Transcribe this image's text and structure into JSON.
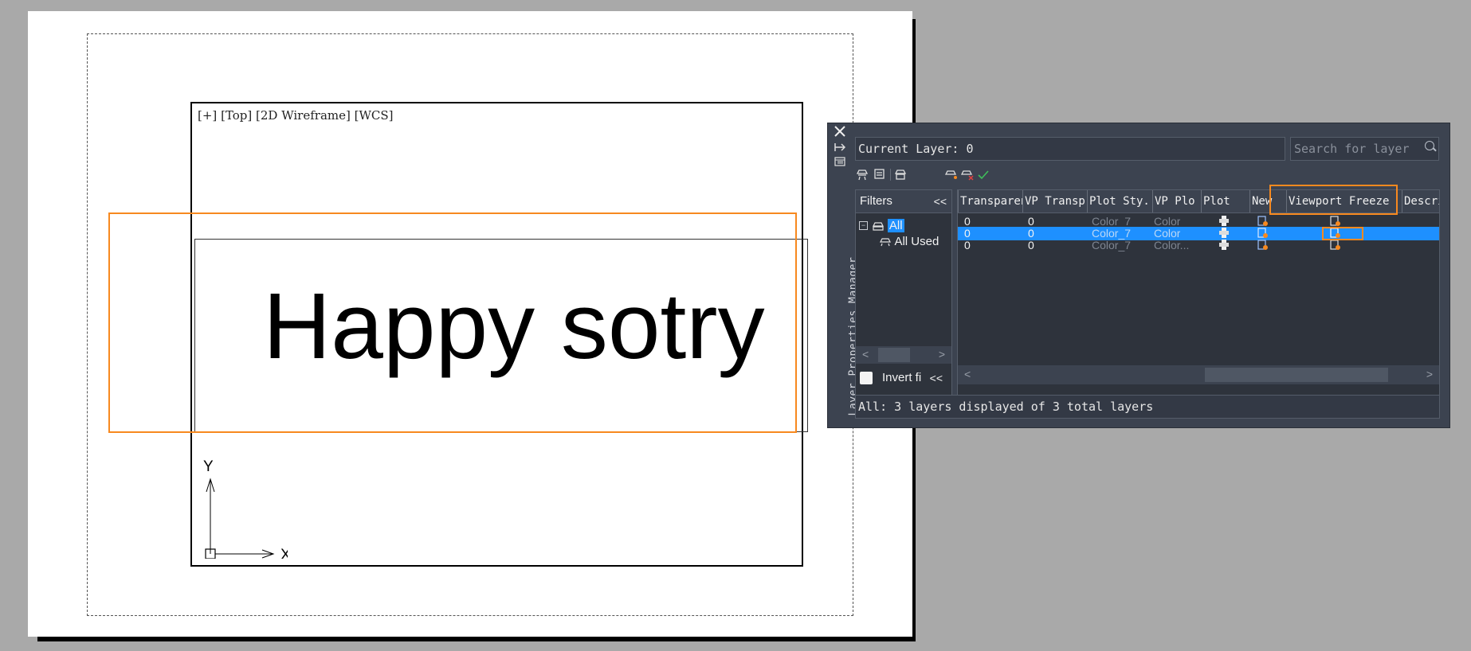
{
  "viewport": {
    "label_plus": "[+]",
    "label_view": "[Top]",
    "label_style": "[2D Wireframe]",
    "label_ucs": "[WCS]",
    "text": "Happy sotry"
  },
  "ucs": {
    "y_label": "Y",
    "x_label": "X"
  },
  "panel": {
    "title": "Layer Properties Manager",
    "current_layer": "Current Layer: 0",
    "search_placeholder": "Search for layer",
    "filters_label": "Filters",
    "filters_collapse": "<<",
    "tree_all": "All",
    "tree_all_used": "All Used",
    "invert_filter": "Invert fi",
    "invert_collapse": "<<",
    "status": "All: 3 layers displayed of 3 total layers",
    "columns": [
      "Transparency",
      "VP Transp",
      "Plot Sty.",
      "VP Plo",
      "Plot",
      "New",
      "Viewport Freeze",
      "Descrip"
    ],
    "rows": [
      {
        "transparency": "0",
        "vp_transparency": "0",
        "plot_style": "Color_7",
        "vp_plot_style": "Color",
        "selected": false
      },
      {
        "transparency": "0",
        "vp_transparency": "0",
        "plot_style": "Color_7",
        "vp_plot_style": "Color",
        "selected": true
      },
      {
        "transparency": "0",
        "vp_transparency": "0",
        "plot_style": "Color_7",
        "vp_plot_style": "Color...",
        "selected": false
      }
    ]
  },
  "colors": {
    "highlight": "#f7891f",
    "selection": "#1e90ff",
    "panel_bg": "#3c4350"
  }
}
